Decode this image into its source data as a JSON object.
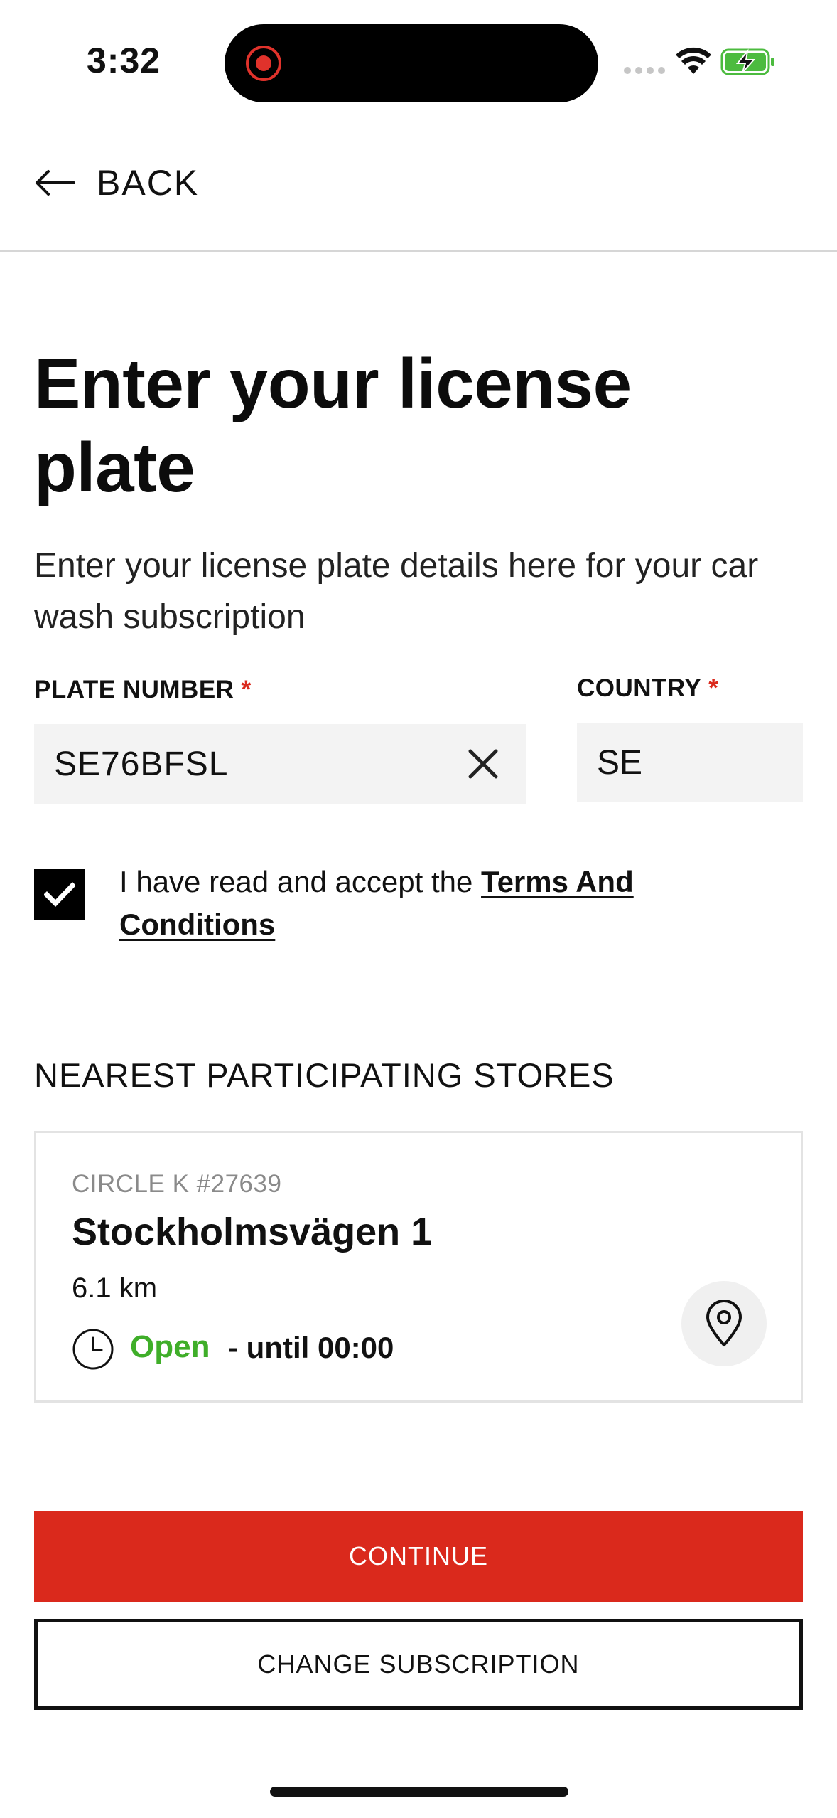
{
  "status_bar": {
    "time": "3:32"
  },
  "header": {
    "back_label": "BACK"
  },
  "page": {
    "title": "Enter your license plate",
    "subtitle": "Enter your license plate details here for your car wash subscription"
  },
  "form": {
    "plate_label": "PLATE NUMBER",
    "plate_value": "SE76BFSL",
    "country_label": "COUNTRY",
    "country_value": "SE",
    "required_marker": "*"
  },
  "terms": {
    "checked": true,
    "text": "I have read and accept the ",
    "link_label": "Terms And Conditions"
  },
  "stores": {
    "heading": "NEAREST PARTICIPATING STORES",
    "items": [
      {
        "id_label": "CIRCLE K #27639",
        "name": "Stockholmsvägen 1",
        "distance": "6.1 km",
        "status": "Open",
        "hours": "- until 00:00"
      }
    ]
  },
  "actions": {
    "continue_label": "CONTINUE",
    "change_label": "CHANGE SUBSCRIPTION"
  },
  "colors": {
    "brand_red": "#da291c",
    "open_green": "#3fae29"
  },
  "icons": {
    "back": "arrow-left-icon",
    "clear": "close-icon",
    "checkbox": "check-icon",
    "clock": "clock-icon",
    "map": "map-pin-icon",
    "wifi": "wifi-icon",
    "battery": "battery-charging-icon"
  }
}
